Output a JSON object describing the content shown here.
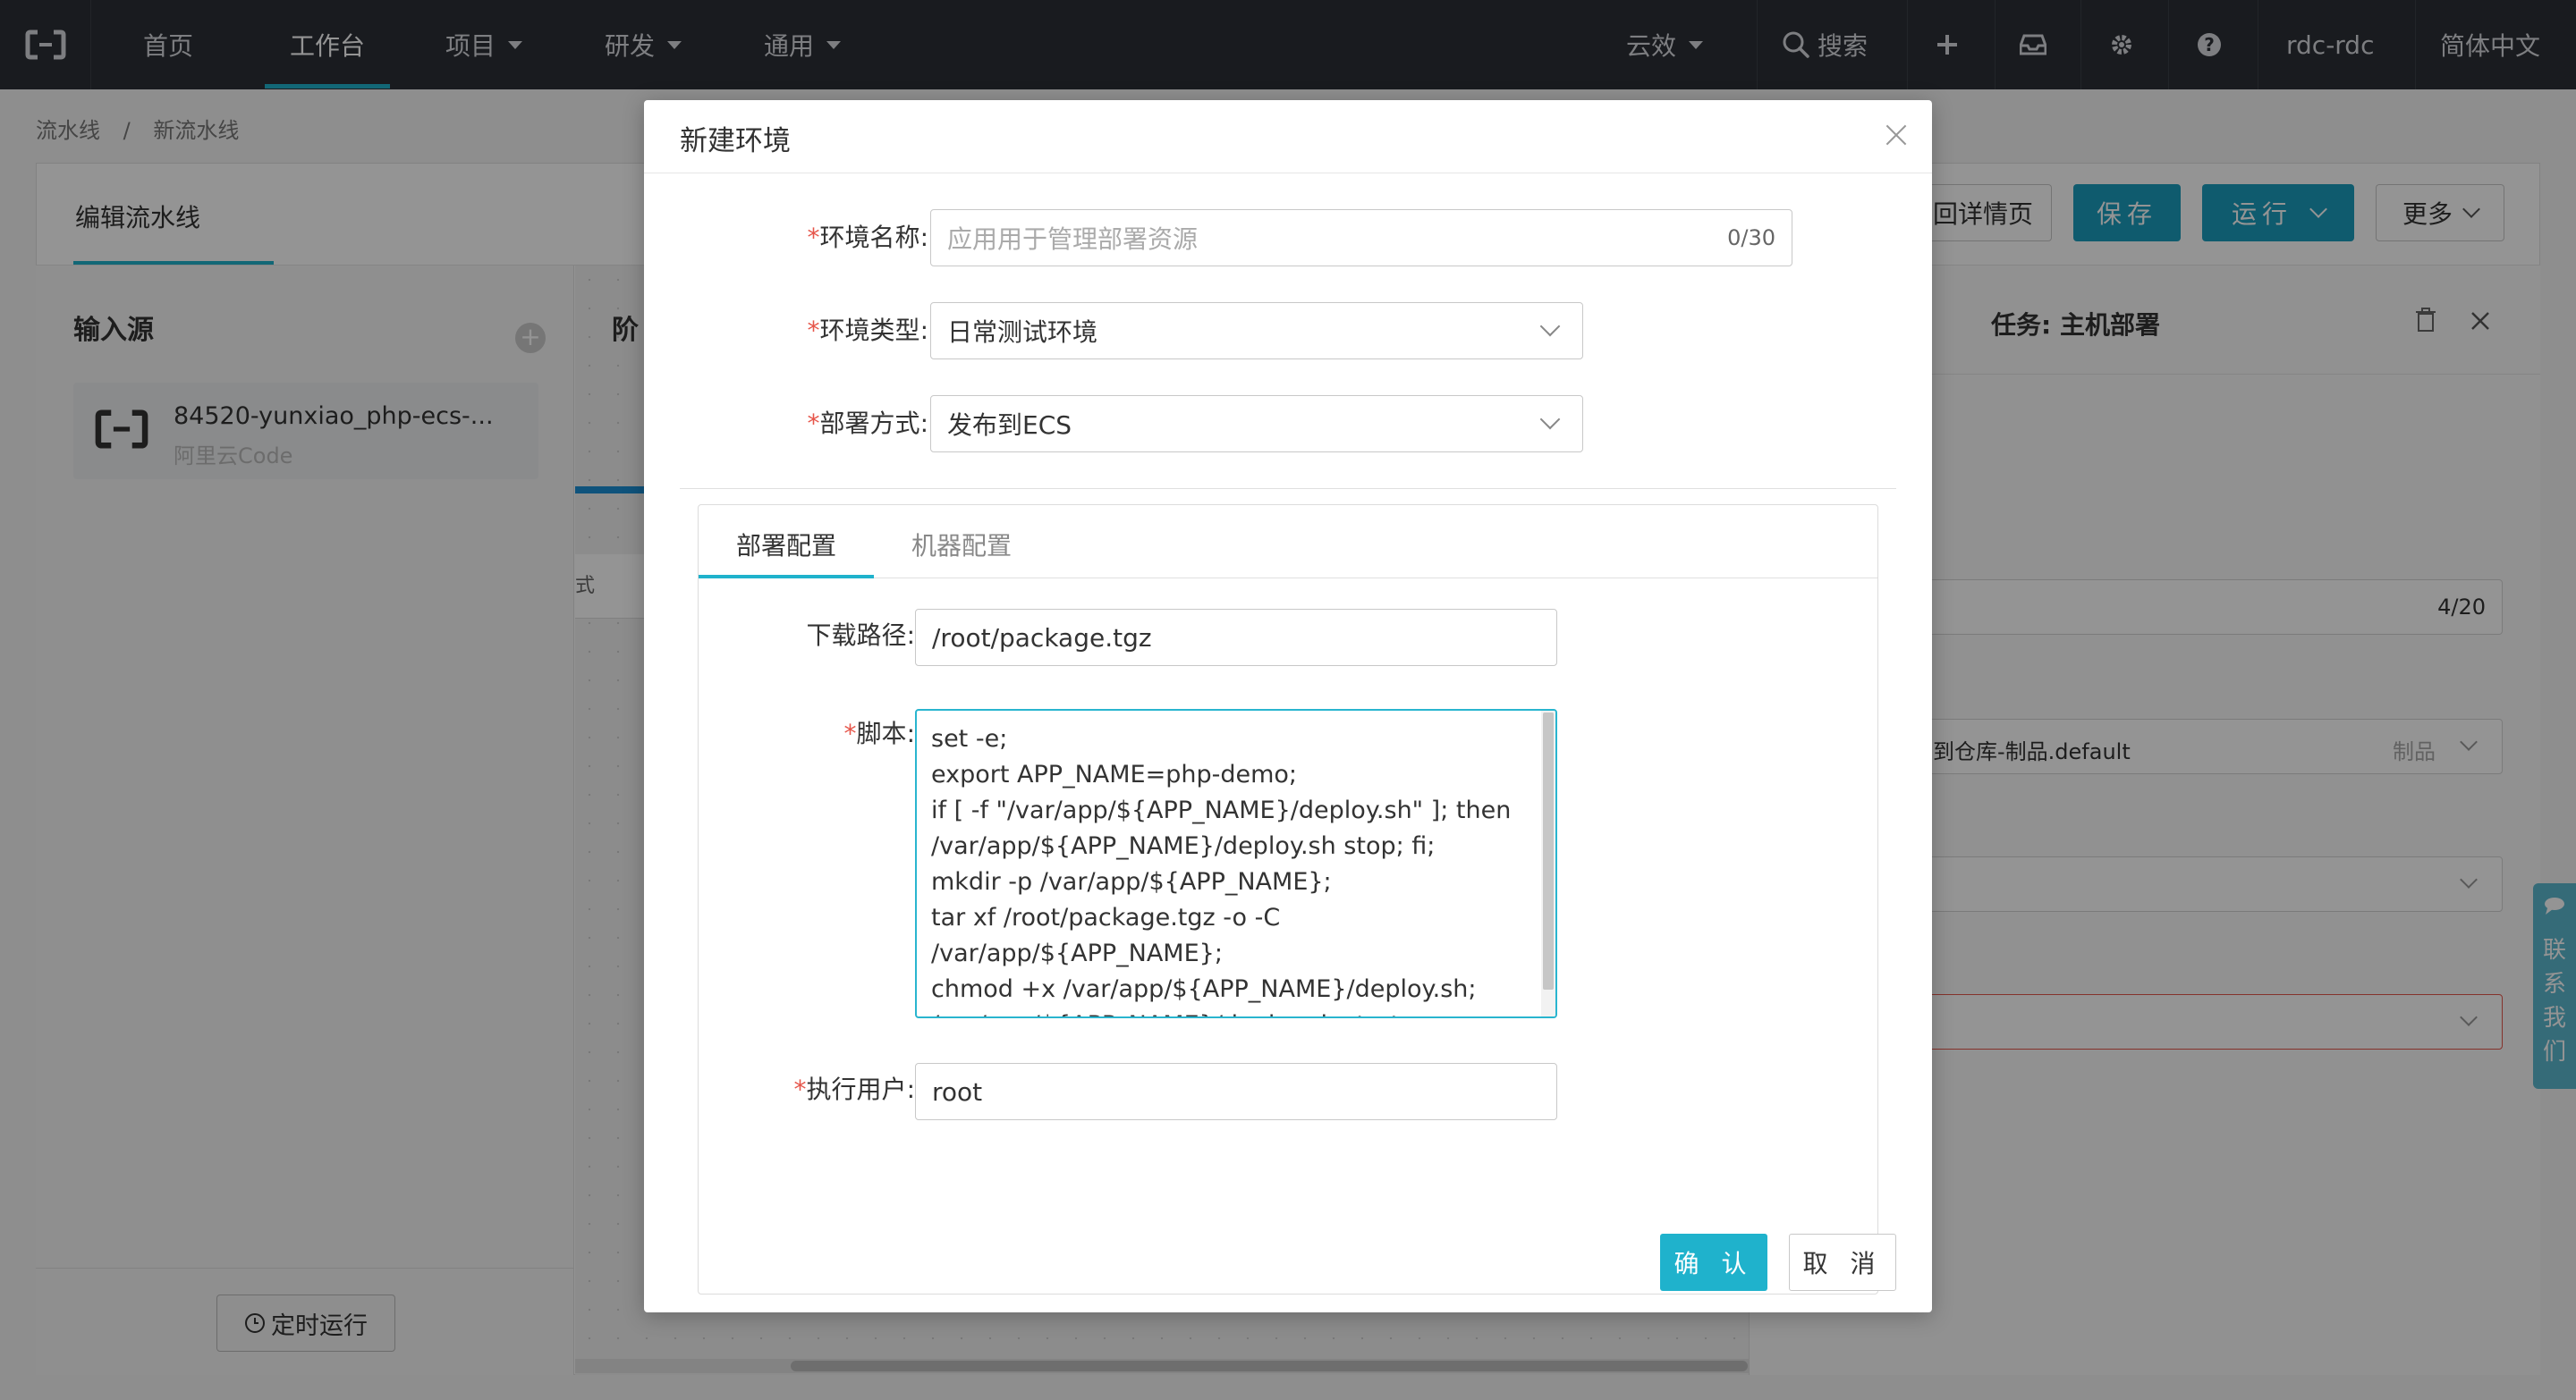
{
  "topnav": {
    "items": [
      {
        "label": "首页"
      },
      {
        "label": "工作台"
      },
      {
        "label": "项目"
      },
      {
        "label": "研发"
      },
      {
        "label": "通用"
      }
    ],
    "org": "云效",
    "search": "搜索",
    "user": "rdc-rdc",
    "language": "简体中文"
  },
  "breadcrumb": [
    "流水线",
    "/",
    "新流水线"
  ],
  "editor": {
    "tab": "编辑流水线",
    "input_source_title": "输入源",
    "source_name": "84520-yunxiao_php-ecs-...",
    "source_type": "阿里云Code",
    "stage_label": "阶",
    "stage_row": "式",
    "timer_button": "定时运行",
    "back_button": "回详情页",
    "save_button": "保存",
    "run_button": "运行",
    "more_button": "更多"
  },
  "task_panel": {
    "title": "任务: 主机部署",
    "counter": "4/20",
    "artifact_text": "到仓库-制品.default",
    "artifact_tag": "制品"
  },
  "contact": "联系我们",
  "modal": {
    "title": "新建环境",
    "env_name_label": "环境名称",
    "env_name_placeholder": "应用用于管理部署资源",
    "env_name_counter": "0/30",
    "env_type_label": "环境类型",
    "env_type_value": "日常测试环境",
    "deploy_method_label": "部署方式",
    "deploy_method_value": "发布到ECS",
    "tabs": [
      {
        "label": "部署配置"
      },
      {
        "label": "机器配置"
      }
    ],
    "download_path_label": "下载路径",
    "download_path_value": "/root/package.tgz",
    "script_label": "脚本",
    "script_lines": [
      "set -e;",
      "export APP_NAME=php-demo;",
      "if [ -f \"/var/app/${APP_NAME}/deploy.sh\" ]; then",
      "/var/app/${APP_NAME}/deploy.sh stop; fi;",
      "mkdir -p /var/app/${APP_NAME};",
      "tar xf /root/package.tgz -o -C",
      "/var/app/${APP_NAME};",
      "chmod +x /var/app/${APP_NAME}/deploy.sh;",
      "/var/app/${APP_NAME}/deploy.sh start;"
    ],
    "exec_user_label": "执行用户",
    "exec_user_value": "root",
    "confirm_button": "确 认",
    "cancel_button": "取 消"
  },
  "colors": {
    "accent": "#1fb2cc",
    "nav_bg": "#2b2f36",
    "required": "#e6564b"
  }
}
